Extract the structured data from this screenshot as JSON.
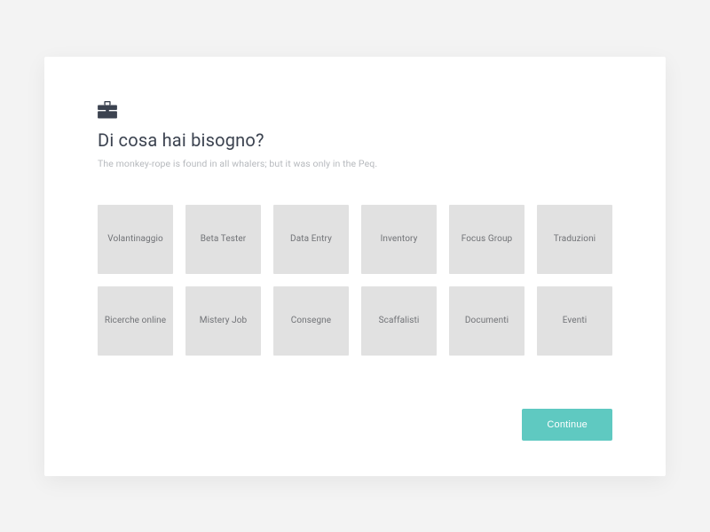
{
  "header": {
    "icon": "briefcase-icon",
    "title": "Di cosa hai bisogno?",
    "subtitle": "The monkey-rope is found in all whalers; but it was only in the Peq."
  },
  "grid": {
    "items": [
      {
        "label": "Volantinaggio"
      },
      {
        "label": "Beta Tester"
      },
      {
        "label": "Data Entry"
      },
      {
        "label": "Inventory"
      },
      {
        "label": "Focus Group"
      },
      {
        "label": "Traduzioni"
      },
      {
        "label": "Ricerche online"
      },
      {
        "label": "Mistery Job"
      },
      {
        "label": "Consegne"
      },
      {
        "label": "Scaffalisti"
      },
      {
        "label": "Documenti"
      },
      {
        "label": "Eventi"
      }
    ]
  },
  "footer": {
    "continue_label": "Continue"
  },
  "colors": {
    "accent": "#5fc9c1",
    "tile_bg": "#e1e1e1",
    "text_dark": "#3c4350",
    "text_muted": "#b6b9bd"
  }
}
